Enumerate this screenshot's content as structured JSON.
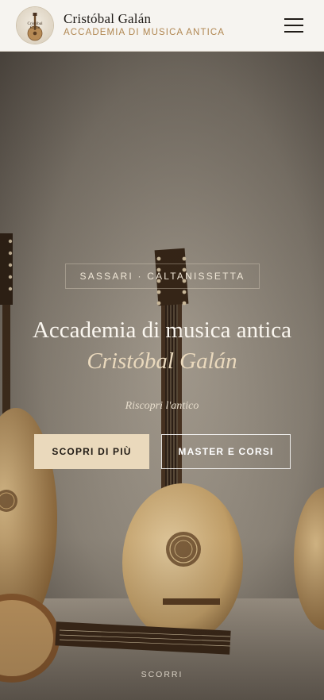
{
  "header": {
    "logo_icon": "lute-emblem-icon",
    "brand_name": "Cristóbal Galán",
    "brand_subtitle": "ACCADEMIA DI MUSICA ANTICA",
    "menu_icon": "hamburger-menu-icon"
  },
  "hero": {
    "location": "SASSARI · CALTANISSETTA",
    "title": "Accademia di musica antica",
    "subtitle": "Cristóbal Galán",
    "tagline": "Riscopri l'antico",
    "primary_button": "SCOPRI DI PIÙ",
    "secondary_button": "MASTER E CORSI",
    "scroll_label": "SCORRI"
  },
  "colors": {
    "accent_gold": "#b08650",
    "button_primary_bg": "#ead9bc",
    "header_bg": "#f6f4f0"
  }
}
